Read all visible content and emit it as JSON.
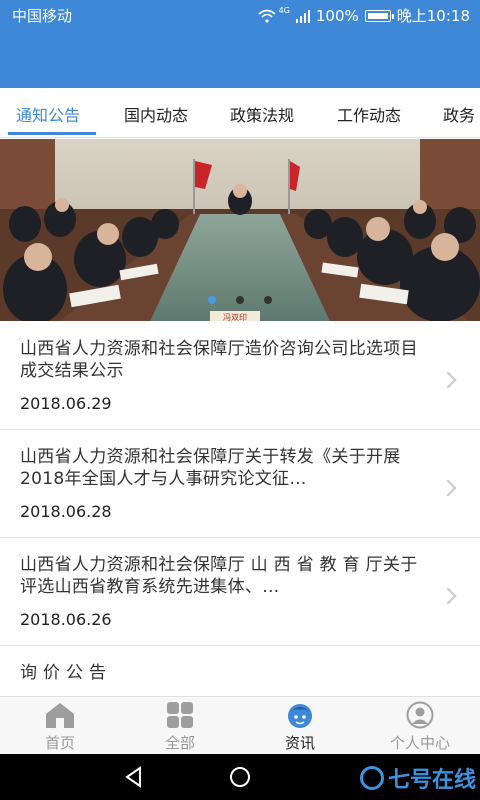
{
  "status_bar": {
    "carrier": "中国移动",
    "network": "4G",
    "battery": "100%",
    "time": "晚上10:18"
  },
  "tabs": [
    {
      "label": "通知公告",
      "active": true
    },
    {
      "label": "国内动态",
      "active": false
    },
    {
      "label": "政策法规",
      "active": false
    },
    {
      "label": "工作动态",
      "active": false
    },
    {
      "label": "政务",
      "active": false
    }
  ],
  "banner": {
    "page_count": 3,
    "active_index": 0,
    "nameplate": "冯双印"
  },
  "news": [
    {
      "title": "山西省人力资源和社会保障厅造价咨询公司比选项目成交结果公示",
      "date": "2018.06.29"
    },
    {
      "title": "山西省人力资源和社会保障厅关于转发《关于开展2018年全国人才与人事研究论文征…",
      "date": "2018.06.28"
    },
    {
      "title": "山西省人力资源和社会保障厅 山 西 省 教 育 厅关于评选山西省教育系统先进集体、…",
      "date": "2018.06.26"
    },
    {
      "title": "询 价 公 告",
      "date": ""
    }
  ],
  "bottom_nav": [
    {
      "label": "首页",
      "icon": "home-icon",
      "active": false
    },
    {
      "label": "全部",
      "icon": "grid-icon",
      "active": false
    },
    {
      "label": "资讯",
      "icon": "news-face-icon",
      "active": true
    },
    {
      "label": "个人中心",
      "icon": "user-icon",
      "active": false
    }
  ],
  "watermark": "七号在线",
  "colors": {
    "brand": "#3f88d8",
    "tab_active": "#3f88d8",
    "text": "#333333",
    "date": "#222222",
    "nav_inactive": "#999999",
    "watermark": "#3b93e0"
  }
}
